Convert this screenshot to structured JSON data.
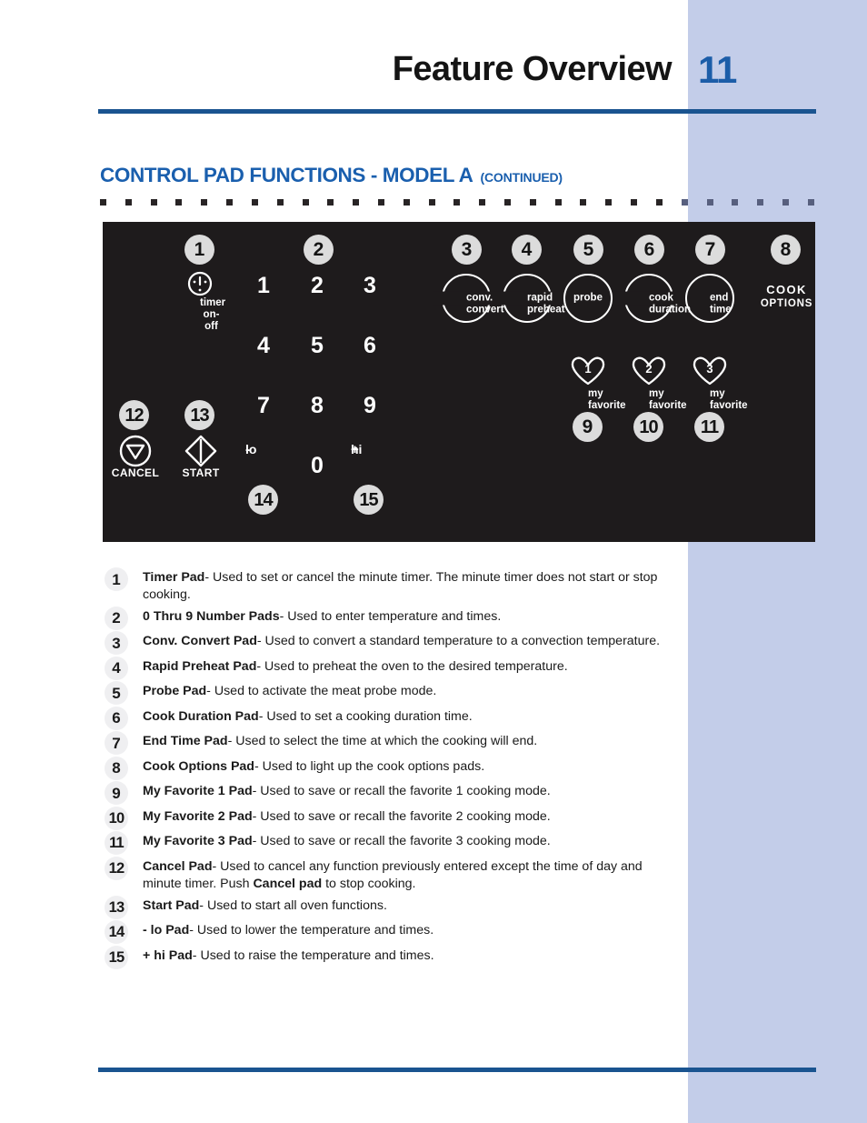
{
  "header": {
    "title": "Feature Overview",
    "page_number": "11",
    "rule_color": "#1a5490"
  },
  "section": {
    "heading": "CONTROL PAD FUNCTIONS - MODEL A",
    "heading_continued": "(CONTINUED)",
    "heading_color": "#1a5fae"
  },
  "sidebar": {
    "band_color": "#c3cde9"
  },
  "panel": {
    "background": "#1e1b1c",
    "callouts": {
      "c1": "1",
      "c2": "2",
      "c3": "3",
      "c4": "4",
      "c5": "5",
      "c6": "6",
      "c7": "7",
      "c8": "8",
      "c9": "9",
      "c10": "10",
      "c11": "11",
      "c12": "12",
      "c13": "13",
      "c14": "14",
      "c15": "15"
    },
    "keys": {
      "timer": {
        "line1": "timer",
        "line2": "on-off"
      },
      "num1": "1",
      "num2": "2",
      "num3": "3",
      "num4": "4",
      "num5": "5",
      "num6": "6",
      "num7": "7",
      "num8": "8",
      "num9": "9",
      "num0": "0",
      "lo": {
        "sym": "-",
        "txt": "lo"
      },
      "hi": {
        "sym": "+",
        "txt": "hi"
      },
      "conv_convert": "conv.\nconvert",
      "conv_convert_l1": "conv.",
      "conv_convert_l2": "convert",
      "rapid_preheat_l1": "rapid",
      "rapid_preheat_l2": "preheat",
      "probe": "probe",
      "cook_duration_l1": "cook",
      "cook_duration_l2": "duration",
      "end_time_l1": "end",
      "end_time_l2": "time",
      "cook_options_l1": "COOK",
      "cook_options_l2": "OPTIONS",
      "fav1_num": "1",
      "fav2_num": "2",
      "fav3_num": "3",
      "fav_l1": "my",
      "fav_l2": "favorite",
      "cancel": "CANCEL",
      "start": "START"
    }
  },
  "list": [
    {
      "n": "1",
      "bold": "Timer Pad",
      "rest": "- Used to set or cancel the minute timer. The minute timer does not start or stop cooking."
    },
    {
      "n": "2",
      "bold": "0 Thru 9 Number Pads",
      "rest": "- Used to enter temperature and times."
    },
    {
      "n": "3",
      "bold": "Conv. Convert Pad",
      "rest": "- Used to convert a standard temperature to a convection temperature."
    },
    {
      "n": "4",
      "bold": "Rapid Preheat Pad",
      "rest": "- Used to preheat the oven to the desired temperature."
    },
    {
      "n": "5",
      "bold": "Probe Pad",
      "rest": "- Used to activate the meat probe mode."
    },
    {
      "n": "6",
      "bold": "Cook Duration Pad",
      "rest": "- Used to set a cooking duration time."
    },
    {
      "n": "7",
      "bold": "End Time Pad",
      "rest": "- Used to select the time at which the cooking will end."
    },
    {
      "n": "8",
      "bold": "Cook Options Pad",
      "rest": "- Used to light up the cook options pads."
    },
    {
      "n": "9",
      "bold": "My Favorite 1 Pad",
      "rest": "- Used to save or recall the favorite 1 cooking mode."
    },
    {
      "n": "10",
      "bold": "My Favorite 2 Pad",
      "rest": "- Used to save or recall the favorite 2 cooking mode."
    },
    {
      "n": "11",
      "bold": "My Favorite 3 Pad",
      "rest": "- Used to save or recall the favorite 3 cooking mode."
    },
    {
      "n": "12",
      "bold": "Cancel Pad",
      "rest": "- Used to cancel any function previously entered except the time of day and minute timer. Push ",
      "bold2": "Cancel pad",
      "rest2": " to stop cooking."
    },
    {
      "n": "13",
      "bold": "Start Pad",
      "rest": "- Used to start all oven functions."
    },
    {
      "n": "14",
      "bold": "- lo Pad",
      "rest": "- Used to lower the temperature and times."
    },
    {
      "n": "15",
      "bold": "+ hi Pad",
      "rest": "- Used to raise the temperature and times."
    }
  ]
}
